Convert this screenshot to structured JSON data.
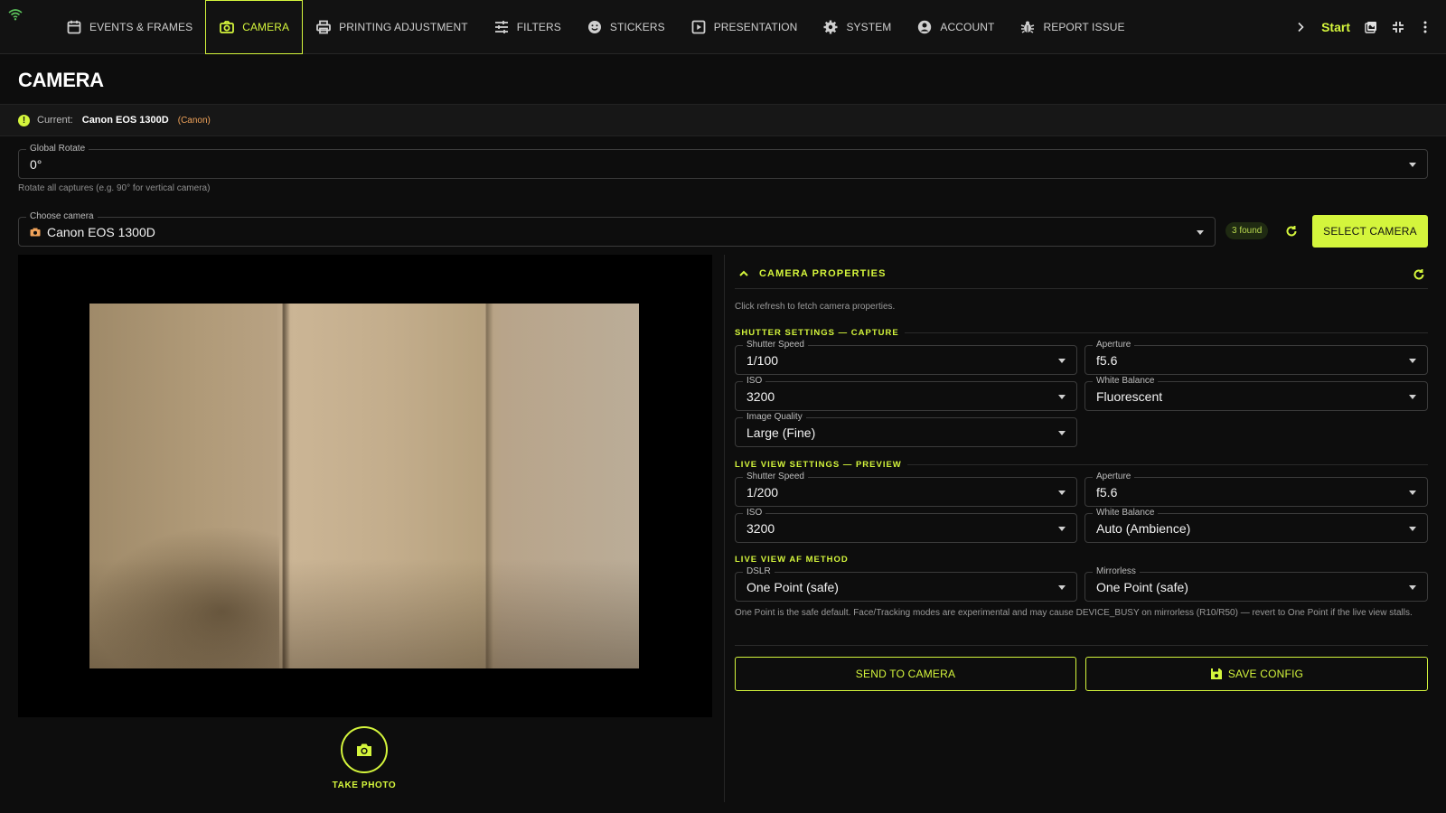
{
  "nav": {
    "items": [
      {
        "label": "EVENTS & FRAMES",
        "icon": "calendar-icon"
      },
      {
        "label": "CAMERA",
        "icon": "camera-icon"
      },
      {
        "label": "PRINTING ADJUSTMENT",
        "icon": "printer-icon"
      },
      {
        "label": "FILTERS",
        "icon": "sliders-icon"
      },
      {
        "label": "STICKERS",
        "icon": "smiley-icon"
      },
      {
        "label": "PRESENTATION",
        "icon": "play-icon"
      },
      {
        "label": "SYSTEM",
        "icon": "gear-icon"
      },
      {
        "label": "ACCOUNT",
        "icon": "user-circle-icon"
      },
      {
        "label": "REPORT ISSUE",
        "icon": "bug-icon"
      }
    ],
    "active": "CAMERA",
    "start_label": "Start"
  },
  "page": {
    "title": "CAMERA",
    "current_label": "Current:",
    "current_value": "Canon EOS 1300D",
    "current_brand": "(Canon)",
    "current_dot": "!"
  },
  "global_rotate": {
    "label": "Global Rotate",
    "value": "0°",
    "helper": "Rotate all captures (e.g. 90° for vertical camera)"
  },
  "choose_camera": {
    "label": "Choose camera",
    "value": "Canon EOS 1300D",
    "found": "3 found",
    "select_label": "SELECT CAMERA"
  },
  "preview": {
    "take_photo_label": "TAKE PHOTO"
  },
  "props": {
    "title": "CAMERA PROPERTIES",
    "hint": "Click refresh to fetch camera properties.",
    "capture_section": "SHUTTER SETTINGS — CAPTURE",
    "capture": {
      "shutter": {
        "label": "Shutter Speed",
        "value": "1/100"
      },
      "aperture": {
        "label": "Aperture",
        "value": "f5.6"
      },
      "iso": {
        "label": "ISO",
        "value": "3200"
      },
      "wb": {
        "label": "White Balance",
        "value": "Fluorescent"
      },
      "quality": {
        "label": "Image Quality",
        "value": "Large (Fine)"
      }
    },
    "live_section": "LIVE VIEW SETTINGS — PREVIEW",
    "live": {
      "shutter": {
        "label": "Shutter Speed",
        "value": "1/200"
      },
      "aperture": {
        "label": "Aperture",
        "value": "f5.6"
      },
      "iso": {
        "label": "ISO",
        "value": "3200"
      },
      "wb": {
        "label": "White Balance",
        "value": "Auto (Ambience)"
      }
    },
    "af_section": "LIVE VIEW AF METHOD",
    "af": {
      "dslr": {
        "label": "DSLR",
        "value": "One Point (safe)"
      },
      "mirrorless": {
        "label": "Mirrorless",
        "value": "One Point (safe)"
      }
    },
    "af_note": "One Point is the safe default. Face/Tracking modes are experimental and may cause DEVICE_BUSY on mirrorless (R10/R50) — revert to One Point if the live view stalls.",
    "send_label": "SEND TO CAMERA",
    "save_label": "SAVE CONFIG"
  },
  "colors": {
    "accent": "#d4f53c",
    "background": "#0d0d0d",
    "brand_orange": "#f0a35a"
  }
}
